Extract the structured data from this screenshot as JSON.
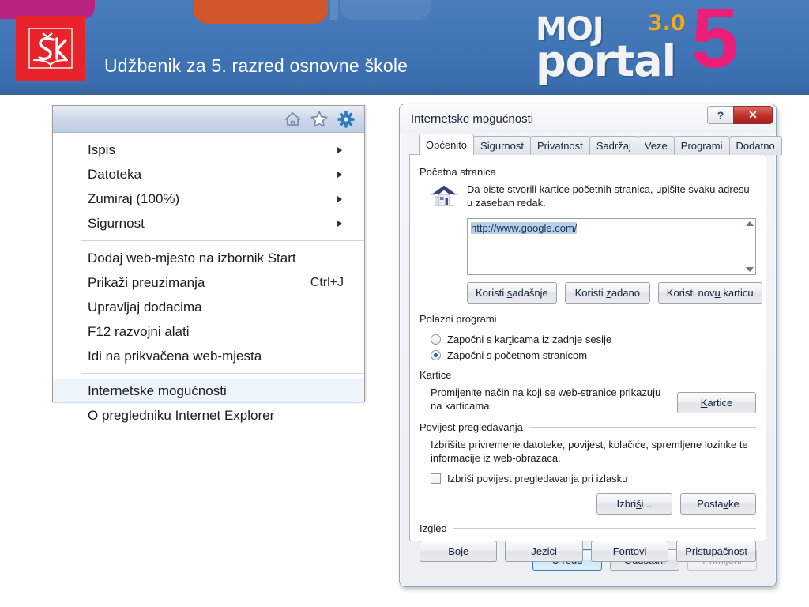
{
  "banner": {
    "title": "Udžbenik za 5. razred osnovne škole",
    "logo_sk": "sk-logo",
    "brand": {
      "line1": "MOJ",
      "line2": "portal",
      "version": "3.0",
      "number": "5"
    },
    "colors": {
      "background_blue": "#3f74b5",
      "magenta": "#b8247f",
      "orange": "#d1572a",
      "sk_red": "#e8232a",
      "brand_pink": "#ed1e79",
      "brand_yellow": "#f0a81e"
    }
  },
  "ie_menu": {
    "toolbar_icons": [
      "home-icon",
      "favorites-star-icon",
      "settings-gear-icon"
    ],
    "items": [
      {
        "label": "Ispis",
        "accel": "",
        "submenu": true
      },
      {
        "label": "Datoteka",
        "accel": "",
        "submenu": true
      },
      {
        "label": "Zumiraj (100%)",
        "accel": "",
        "submenu": true
      },
      {
        "label": "Sigurnost",
        "accel": "",
        "submenu": true
      },
      {
        "label": "Dodaj web-mjesto na izbornik Start",
        "accel": "",
        "submenu": false
      },
      {
        "label": "Prikaži preuzimanja",
        "accel": "Ctrl+J",
        "submenu": false
      },
      {
        "label": "Upravljaj dodacima",
        "accel": "",
        "submenu": false
      },
      {
        "label": "F12 razvojni alati",
        "accel": "",
        "submenu": false
      },
      {
        "label": "Idi na prikvačena web-mjesta",
        "accel": "",
        "submenu": false
      },
      {
        "label": "Internetske mogućnosti",
        "accel": "",
        "submenu": false
      },
      {
        "label": "O pregledniku Internet Explorer",
        "accel": "",
        "submenu": false
      }
    ]
  },
  "dialog": {
    "title": "Internetske mogućnosti",
    "help_button": "?",
    "close_button": "✕",
    "tabs": [
      "Općenito",
      "Sigurnost",
      "Privatnost",
      "Sadržaj",
      "Veze",
      "Programi",
      "Dodatno"
    ],
    "active_tab": "Općenito",
    "home_page": {
      "group_label": "Početna stranica",
      "description": "Da biste stvorili kartice početnih stranica, upišite svaku adresu u zaseban redak.",
      "url_value": "http://www.google.com/",
      "buttons": [
        "Koristi sadašnje",
        "Koristi zadano",
        "Koristi novu karticu"
      ]
    },
    "startup": {
      "group_label": "Polazni programi",
      "options": [
        {
          "label": "Započni s karticama iz zadnje sesije",
          "selected": false
        },
        {
          "label": "Započni s početnom stranicom",
          "selected": true
        }
      ]
    },
    "tabs_section": {
      "group_label": "Kartice",
      "description": "Promijenite način na koji se web-stranice prikazuju na karticama.",
      "button": "Kartice"
    },
    "history": {
      "group_label": "Povijest pregledavanja",
      "description": "Izbrišite privremene datoteke, povijest, kolačiće, spremljene lozinke te informacije iz web-obrazaca.",
      "checkbox_label": "Izbriši povijest pregledavanja pri izlasku",
      "checkbox_checked": false,
      "buttons": [
        "Izbriši...",
        "Postavke"
      ]
    },
    "appearance": {
      "group_label": "Izgled",
      "buttons": [
        "Boje",
        "Jezici",
        "Fontovi",
        "Pristupačnost"
      ]
    },
    "footer": {
      "ok": "U redu",
      "cancel": "Odustani",
      "apply": "Primijeni",
      "apply_disabled": true
    }
  }
}
